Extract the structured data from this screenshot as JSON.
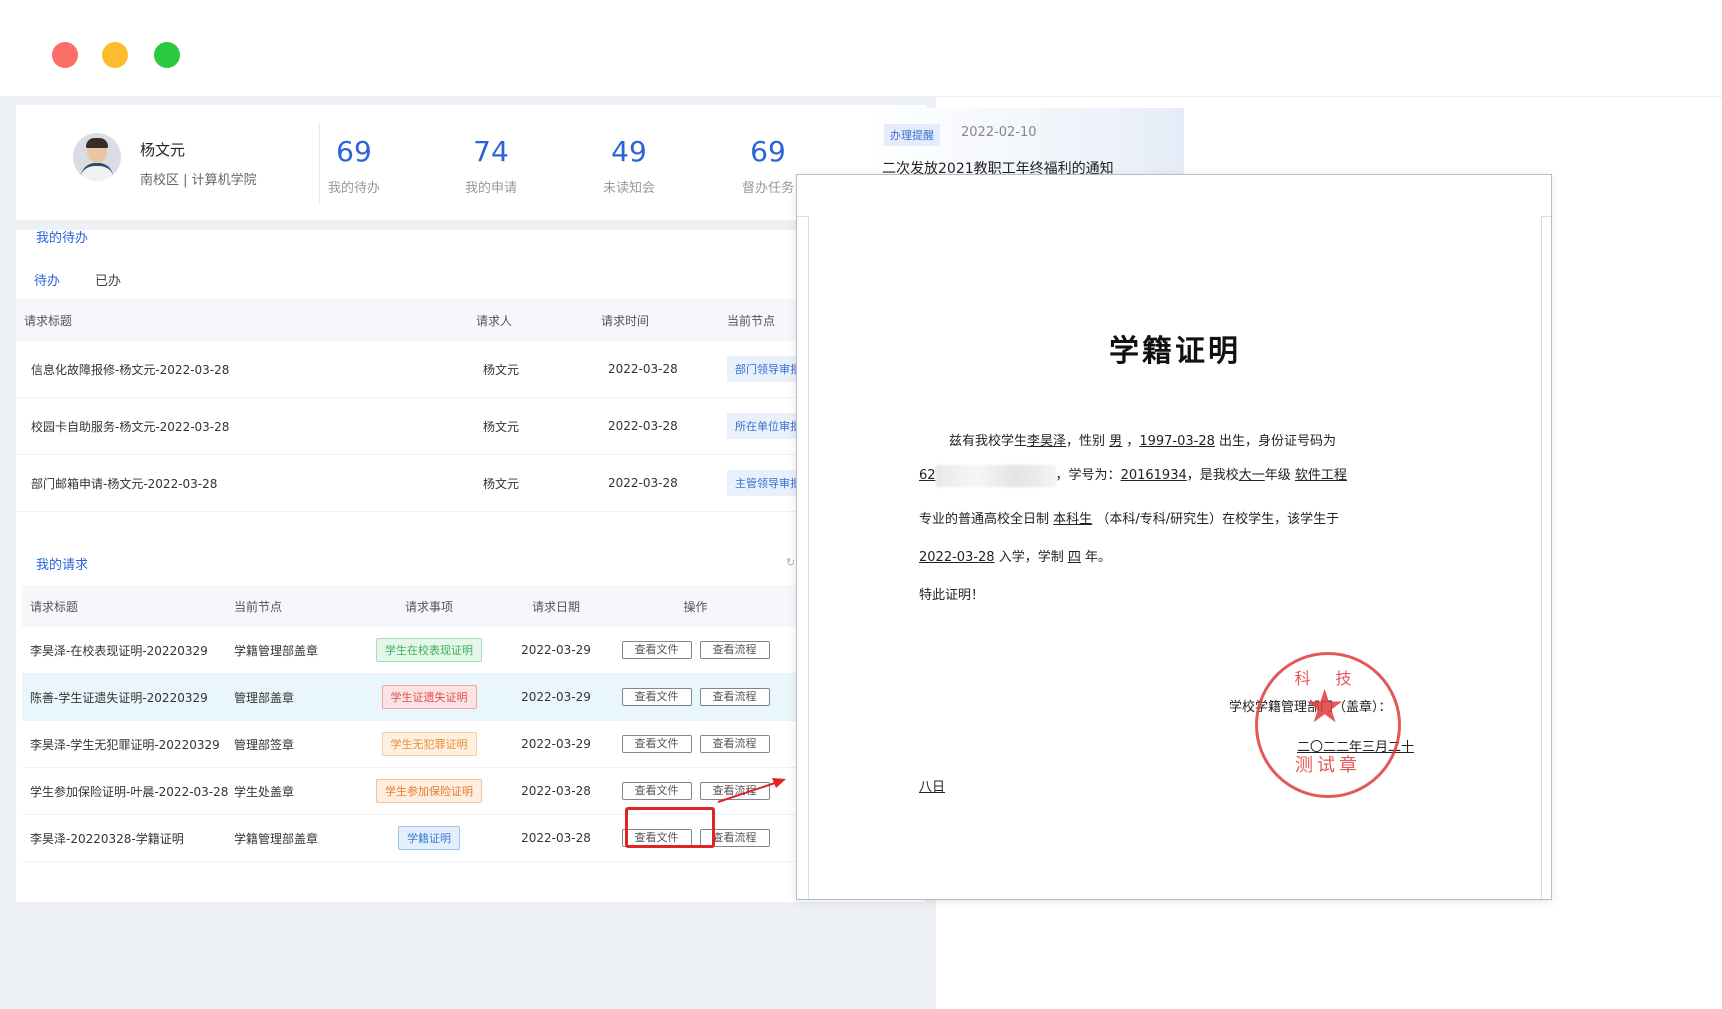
{
  "profile": {
    "name": "杨文元",
    "dept": "南校区 | 计算机学院",
    "stats": [
      {
        "num": "69",
        "label": "我的待办"
      },
      {
        "num": "74",
        "label": "我的申请"
      },
      {
        "num": "49",
        "label": "未读知会"
      },
      {
        "num": "69",
        "label": "督办任务"
      }
    ]
  },
  "notice": {
    "badge": "办理提醒",
    "date": "2022-02-10",
    "title": "二次发放2021教职工年终福利的通知"
  },
  "todo": {
    "title": "我的待办",
    "tabs": [
      "待办",
      "已办"
    ],
    "columns": [
      "请求标题",
      "请求人",
      "请求时间",
      "当前节点"
    ],
    "rows": [
      {
        "title": "信息化故障报修-杨文元-2022-03-28",
        "person": "杨文元",
        "time": "2022-03-28",
        "node": "部门领导审批"
      },
      {
        "title": "校园卡自助服务-杨文元-2022-03-28",
        "person": "杨文元",
        "time": "2022-03-28",
        "node": "所在单位审批"
      },
      {
        "title": "部门邮箱申请-杨文元-2022-03-28",
        "person": "杨文元",
        "time": "2022-03-28",
        "node": "主管领导审批"
      }
    ]
  },
  "requests": {
    "title": "我的请求",
    "columns": [
      "请求标题",
      "当前节点",
      "请求事项",
      "请求日期",
      "操作"
    ],
    "view_file": "查看文件",
    "view_flow": "查看流程",
    "rows": [
      {
        "title": "李昊泽-在校表现证明-20220329",
        "node": "学籍管理部盖章",
        "item": "学生在校表现证明",
        "date": "2022-03-29"
      },
      {
        "title": "陈善-学生证遗失证明-20220329",
        "node": "管理部盖章",
        "item": "学生证遗失证明",
        "date": "2022-03-29"
      },
      {
        "title": "李昊泽-学生无犯罪证明-20220329",
        "node": "管理部签章",
        "item": "学生无犯罪证明",
        "date": "2022-03-29"
      },
      {
        "title": "学生参加保险证明-叶晨-2022-03-28",
        "node": "学生处盖章",
        "item": "学生参加保险证明",
        "date": "2022-03-28"
      },
      {
        "title": "李昊泽-20220328-学籍证明",
        "node": "学籍管理部盖章",
        "item": "学籍证明",
        "date": "2022-03-28"
      }
    ]
  },
  "doc": {
    "title": "学籍证明",
    "l1_a": "兹有我校学生",
    "name": "李昊泽",
    "l1_b": "，性别",
    "gender": "男",
    "birth": "1997-03-28",
    "l1_c": "出生，身份证号码为",
    "id_prefix": "62",
    "l2_a": "，学号为：",
    "sid": "20161934",
    "l2_b": "，是我校",
    "grade": "大一",
    "l2_c": "年级",
    "major": "软件工程",
    "l3_a": "专业的普通高校全日制",
    "level": "本科生",
    "l3_b": "（本科/专科/研究生）在校学生，该学生于",
    "enroll": "2022-03-28",
    "l4_a": "入学，学制",
    "years": "四",
    "l4_b": "年。",
    "closing": "特此证明！",
    "sign": "学校学籍管理部门（盖章）：",
    "date_cn": "二〇二二年三月二十",
    "date_cn2": "八日",
    "seal_top": "科 技",
    "seal_text": "测试章"
  }
}
